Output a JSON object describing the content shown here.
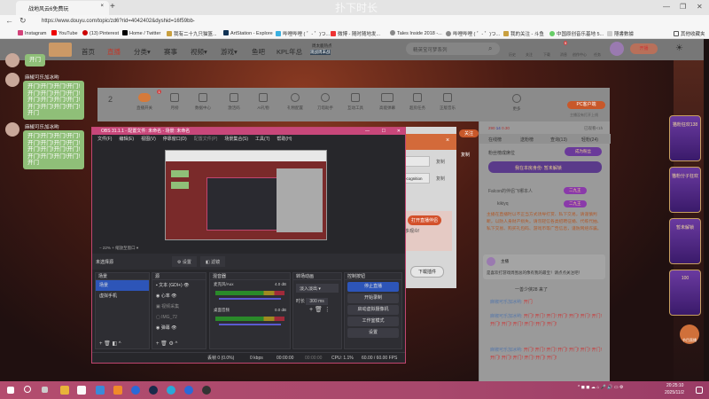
{
  "browser": {
    "tab_title": "战地风云6免费玩",
    "close": "×",
    "new_tab": "+",
    "watermark": "扑下时长",
    "url": "https://www.douyu.com/topic/zd6?rid=4042402&dyshid=16f59bb-c5e83d7585fbae224a9e173600041701",
    "bookmarks": [
      "Instagram",
      "YouTube",
      "(13) Pinterest",
      "Home / Twitter",
      "我有二十九只猫篮...",
      "ArtStation - Explore",
      "哔哩哔哩 ( ゜- ゜)つ...",
      "微博 - 随时随地发...",
      "Tales Inside 2018 -...",
      "哔哩哔哩 ( ゜- ゜)つ...",
      "我的关注 - 斗鱼",
      "中国原创音乐基地 5...",
      "隱書數據",
      "其他收藏夹"
    ],
    "window_controls": [
      "—",
      "❐",
      "✕"
    ]
  },
  "site": {
    "nav": [
      "首页",
      "直播",
      "分类▾",
      "赛事",
      "视频▾",
      "游戏▾",
      "鱼吧",
      "KPL年总"
    ],
    "promo": [
      "周太鹿热点",
      "观战周末战"
    ],
    "search_placeholder": "精英宝可梦系列",
    "header_icons": [
      "历史",
      "关注",
      "下载",
      "消息",
      "创作中心",
      "任务"
    ],
    "notif_badge": "9",
    "start_live": "开播",
    "tools": [
      "直播开关",
      "月榜",
      "数据中心",
      "激活码",
      "AI礼物",
      "礼物配置",
      "刀塔助手",
      "互动工具",
      "高能弹幕",
      "超房任务",
      "正版音乐",
      "更多"
    ],
    "tools_badge": "1",
    "score": "2",
    "pc_client": "PC客户端",
    "pc_note": "主播没有打开上线",
    "stats": {
      "users": "290",
      "level": "14",
      "gifts": "0.30",
      "watched": "已观看<1h"
    },
    "rank_tabs": [
      "在线榜",
      "送粉榜",
      "查询(13)",
      "轻粉(24)"
    ],
    "fans_title": "粉丝榜成席位",
    "rank_btn": "成为粉丝",
    "unlock_text": "我在本房身份: 暂未解锁",
    "rank_users": [
      "Falcon的伴侣飞哪本人",
      "kikiyq"
    ],
    "rank_badge": "二九王",
    "notice": "主播在直播时以不正当方式诱导打赏、私下交易，请谨慎判断，以防人身财产损失。请勿轻信各类招聘征婚、代练代抽、私下交易、购买礼包码、游戏币等广告信息，谨防网络诈骗。",
    "host_label": "主播",
    "host_msg": "是喜欢打游戏周围总的像有我的最宝！请点点关注吧！",
    "enter_msg": "一善少侠28 来了",
    "chat_user": "麻椒可乐加冰哟:",
    "chat_msgs": [
      "开门",
      "开门! 开门! 开门! 开门! 开门! 开门! 开门! 开门! 开门! 开门! 开门! 开门! 开门!",
      "开门! 开门! 开门! 开门! 开门! 开门! 开门! 开门! 开门! 开门! 开门! 开门! 开门!"
    ],
    "ads": [
      "猫粉狂欢138",
      "猫粉分子狂欢",
      "暂未解锁",
      "100"
    ],
    "download_icon": "节目直播"
  },
  "overlay_chat": [
    {
      "name": "麻椒可乐加冰哟",
      "text": "开门"
    },
    {
      "name": "麻椒可乐加冰哟",
      "text": "开门!开门!开门!开门!\n开门!开门!开门!开门!\n开门!开门!开门!开门!\n开门!开门!开门!开门!\n开门"
    },
    {
      "name": "麻椒可乐加冰哟",
      "text": "开门!开门!开门!开门!\n开门!开门!开门!开门!\n开门!开门!开门!开门!\n开门!开门!开门!开门!\n开门"
    }
  ],
  "obs": {
    "title": "OBS 31.1.1 - 配置文件: 未命名 - 场景: 未命名",
    "menu": [
      "文件(F)",
      "编辑(E)",
      "视图(V)",
      "停靠窗口(D)",
      "配置文件(P)",
      "场景集合(S)",
      "工具(T)",
      "帮助(H)"
    ],
    "zoom": "22%",
    "zoom_mode": "缩放至窗口",
    "no_source": "未选择源",
    "props_btn": "设置",
    "filters_btn": "滤镜",
    "docks": {
      "scenes": "场景",
      "sources": "源",
      "mixer": "混音器",
      "transitions": "转场动画",
      "controls": "控制按钮"
    },
    "scenes": [
      "场景",
      "虚拟手机"
    ],
    "sources": [
      "文本 (GDI+)",
      "心率",
      "视频采集",
      "IMG_72",
      "弹幕"
    ],
    "mixer": [
      {
        "name": "麦克风/Aux",
        "db": "4.0 dB"
      },
      {
        "name": "桌面音频",
        "db": "0.0 dB"
      }
    ],
    "transition": "淡入淡出",
    "duration_label": "时长",
    "duration": "300 ms",
    "controls": [
      "停止直播",
      "开始录制",
      "启动虚拟摄像机",
      "工作室模式",
      "设置"
    ],
    "status": [
      "丢帧 0 (0.0%)",
      "0 kbps",
      "00:00:00",
      "00:00:00",
      "CPU: 1.1%",
      "60.00 / 60.00 FPS"
    ]
  },
  "dialog": {
    "copy": "复制",
    "input2": "ecognition",
    "open_btn": "打开直播伴侣",
    "hint": "多观众!",
    "download_btn": "下载插件",
    "follow": "关注",
    "client": "客户端"
  },
  "taskbar": {
    "time": "20:25:10",
    "date": "2025/11/2"
  }
}
